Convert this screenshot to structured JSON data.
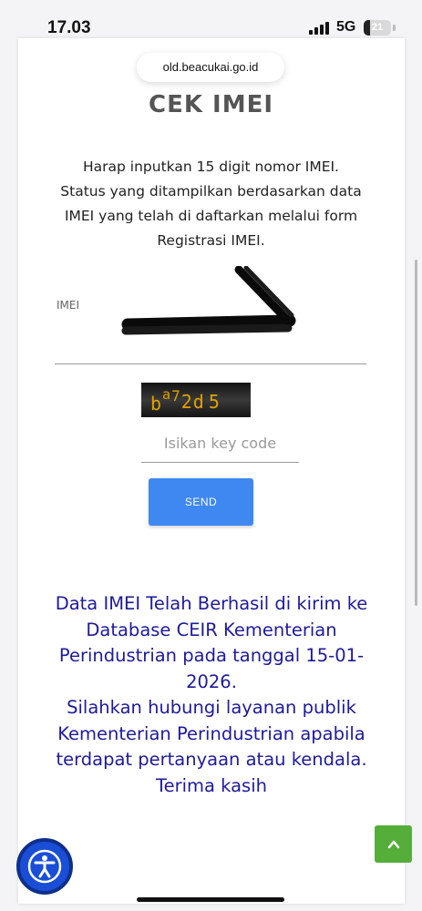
{
  "status_bar": {
    "time": "17.03",
    "network": "5G",
    "battery": "21"
  },
  "browser": {
    "url": "old.beacukai.go.id"
  },
  "page": {
    "title": "CEK IMEI",
    "intro_lines": [
      "Harap inputkan 15 digit nomor IMEI.",
      "Status yang ditampilkan berdasarkan data",
      "IMEI yang telah di daftarkan melalui form",
      "Registrasi IMEI."
    ],
    "imei_label": "IMEI",
    "captcha": {
      "chars": [
        "b",
        "a",
        "7",
        "2",
        "d",
        "5"
      ]
    },
    "keycode_placeholder": "Isikan key code",
    "send_label": "SEND",
    "result_lines": [
      "Data IMEI Telah Berhasil di kirim ke",
      "Database CEIR Kementerian",
      "Perindustrian pada tanggal 15-01-",
      "2026.",
      "Silahkan hubungi layanan publik",
      "Kementerian Perindustrian apabila",
      "terdapat pertanyaan atau kendala.",
      "Terima kasih"
    ]
  },
  "colors": {
    "send_button": "#3f88f1",
    "result_text": "#1e1a9c",
    "accessibility_button": "#1a4ed6",
    "scroll_top_button": "#55ae3a"
  },
  "icons": {
    "accessibility": "accessibility-icon",
    "scroll_top": "chevron-up-icon",
    "signal": "signal-icon",
    "battery": "battery-icon"
  }
}
